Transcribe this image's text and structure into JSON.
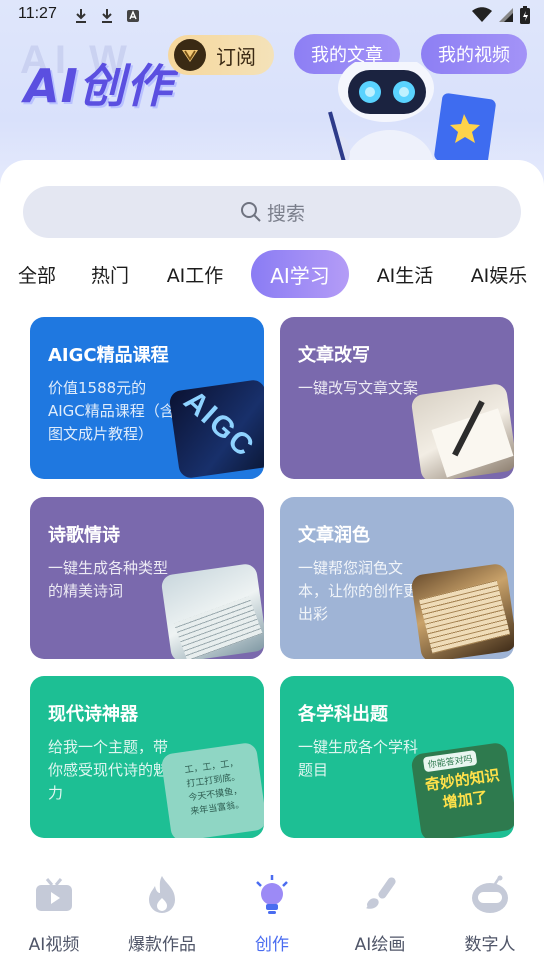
{
  "status": {
    "time": "11:27"
  },
  "header": {
    "brand": "AI创作",
    "subscribe_label": "订阅",
    "my_articles_label": "我的文章",
    "my_videos_label": "我的视频"
  },
  "search": {
    "placeholder": "搜索"
  },
  "tabs": [
    {
      "label": "全部",
      "active": false
    },
    {
      "label": "热门",
      "active": false
    },
    {
      "label": "AI工作",
      "active": false
    },
    {
      "label": "AI学习",
      "active": true
    },
    {
      "label": "AI生活",
      "active": false
    },
    {
      "label": "AI娱乐",
      "active": false
    }
  ],
  "cards": [
    {
      "title": "AIGC精品课程",
      "desc": "价值1588元的AIGC精品课程（含图文成片教程）",
      "color": "#1f78e0"
    },
    {
      "title": "文章改写",
      "desc": "一键改写文章文案",
      "color": "#7a69ad"
    },
    {
      "title": "诗歌情诗",
      "desc": "一键生成各种类型的精美诗词",
      "color": "#7a69ad"
    },
    {
      "title": "文章润色",
      "desc": "一键帮您润色文本，让你的创作更出彩",
      "color": "#9fb4d6"
    },
    {
      "title": "现代诗神器",
      "desc": "给我一个主题，带你感受现代诗的魅力",
      "color": "#1dbf94"
    },
    {
      "title": "各学科出题",
      "desc": "一键生成各个学科题目",
      "color": "#1dbf94"
    }
  ],
  "thumb_texts": {
    "aigc": "AIGC",
    "poem": "工，工，工，\n打工打到底。\n今天不摸鱼，\n来年当富翁。",
    "quiz": "奇妙的知识增加了",
    "quiz_badge": "你能答对吗"
  },
  "bottom_nav": [
    {
      "label": "AI视频",
      "icon": "tv-icon",
      "active": false
    },
    {
      "label": "爆款作品",
      "icon": "flame-icon",
      "active": false
    },
    {
      "label": "创作",
      "icon": "lightbulb-icon",
      "active": true
    },
    {
      "label": "AI绘画",
      "icon": "brush-icon",
      "active": false
    },
    {
      "label": "数字人",
      "icon": "robot-head-icon",
      "active": false
    }
  ],
  "colors": {
    "accent": "#4a6cf0",
    "brand": "#5b4fe0",
    "pill": "#8d7ff4",
    "tab_active": "#8a7cf4"
  }
}
